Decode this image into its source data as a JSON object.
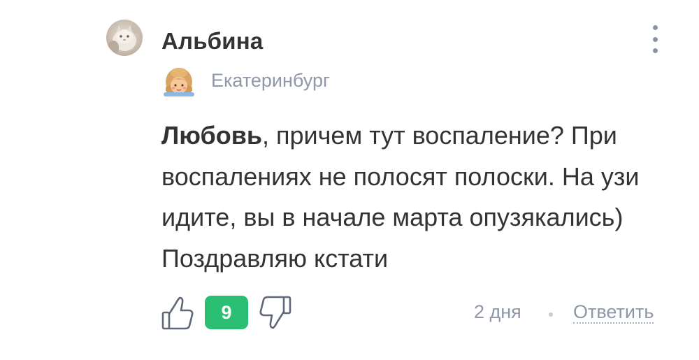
{
  "comment": {
    "author": "Альбина",
    "location": "Екатеринбург",
    "mention": "Любовь",
    "text": ", причем тут воспаление? При воспалениях не полосят полоски. На узи идите, вы в начале марта опузякались) Поздравляю кстати",
    "rating": "9",
    "time": "2 дня",
    "reply_label": "Ответить"
  },
  "icons": {
    "avatar": "cat-photo-avatar",
    "status": "girl-face-icon",
    "more": "more-vertical-icon",
    "like": "thumbs-up-icon",
    "dislike": "thumbs-down-icon"
  },
  "colors": {
    "rating_badge": "#2bbf74",
    "text": "#333333",
    "muted": "#8e98a8"
  }
}
